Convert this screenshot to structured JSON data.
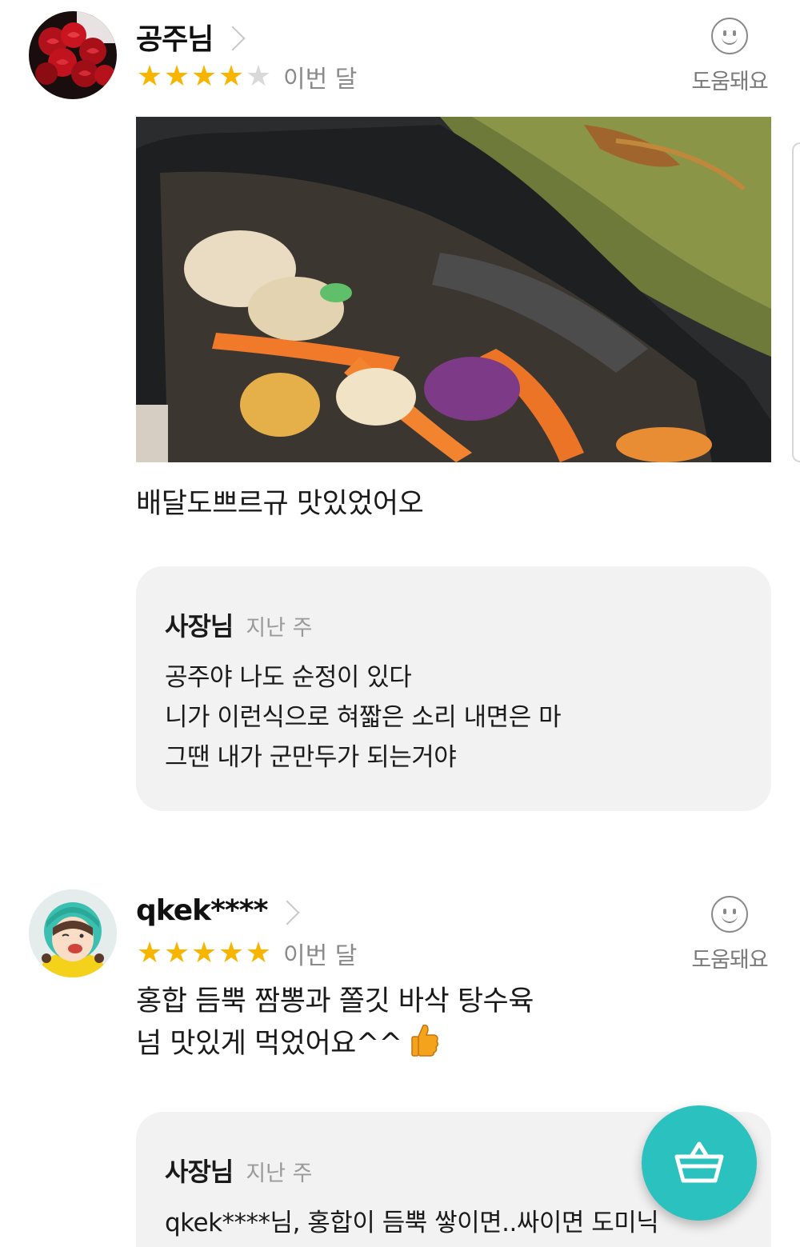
{
  "reviews": [
    {
      "username": "공주님",
      "rating": 4,
      "rating_max": 5,
      "date": "이번 달",
      "helpful_label": "도움돼요",
      "has_photo": true,
      "text_lines": [
        "배달도쁘르규 맛있었어오"
      ],
      "reply": {
        "author": "사장님",
        "date": "지난 주",
        "lines": [
          "공주야 나도 순정이 있다",
          "니가 이런식으로 혀짧은 소리 내면은 마",
          "그땐 내가 군만두가 되는거야"
        ]
      }
    },
    {
      "username": "qkek****",
      "rating": 5,
      "rating_max": 5,
      "date": "이번 달",
      "helpful_label": "도움돼요",
      "has_photo": false,
      "text_lines": [
        "홍합 듬뿍 짬뽕과 쫄깃 바삭 탕수육",
        "넘 맛있게 먹었어요^^"
      ],
      "text_emoji": "thumbs-up",
      "reply": {
        "author": "사장님",
        "date": "지난 주",
        "lines": [
          "qkek****님, 홍합이 듬뿍 쌓이면..싸이면 도미닉"
        ]
      }
    }
  ],
  "cart_button": {
    "icon": "basket-icon",
    "color": "#2bc1be"
  },
  "colors": {
    "star_on": "#f7b500",
    "star_off": "#d9d9d9",
    "reply_bg": "#f2f2f2"
  }
}
